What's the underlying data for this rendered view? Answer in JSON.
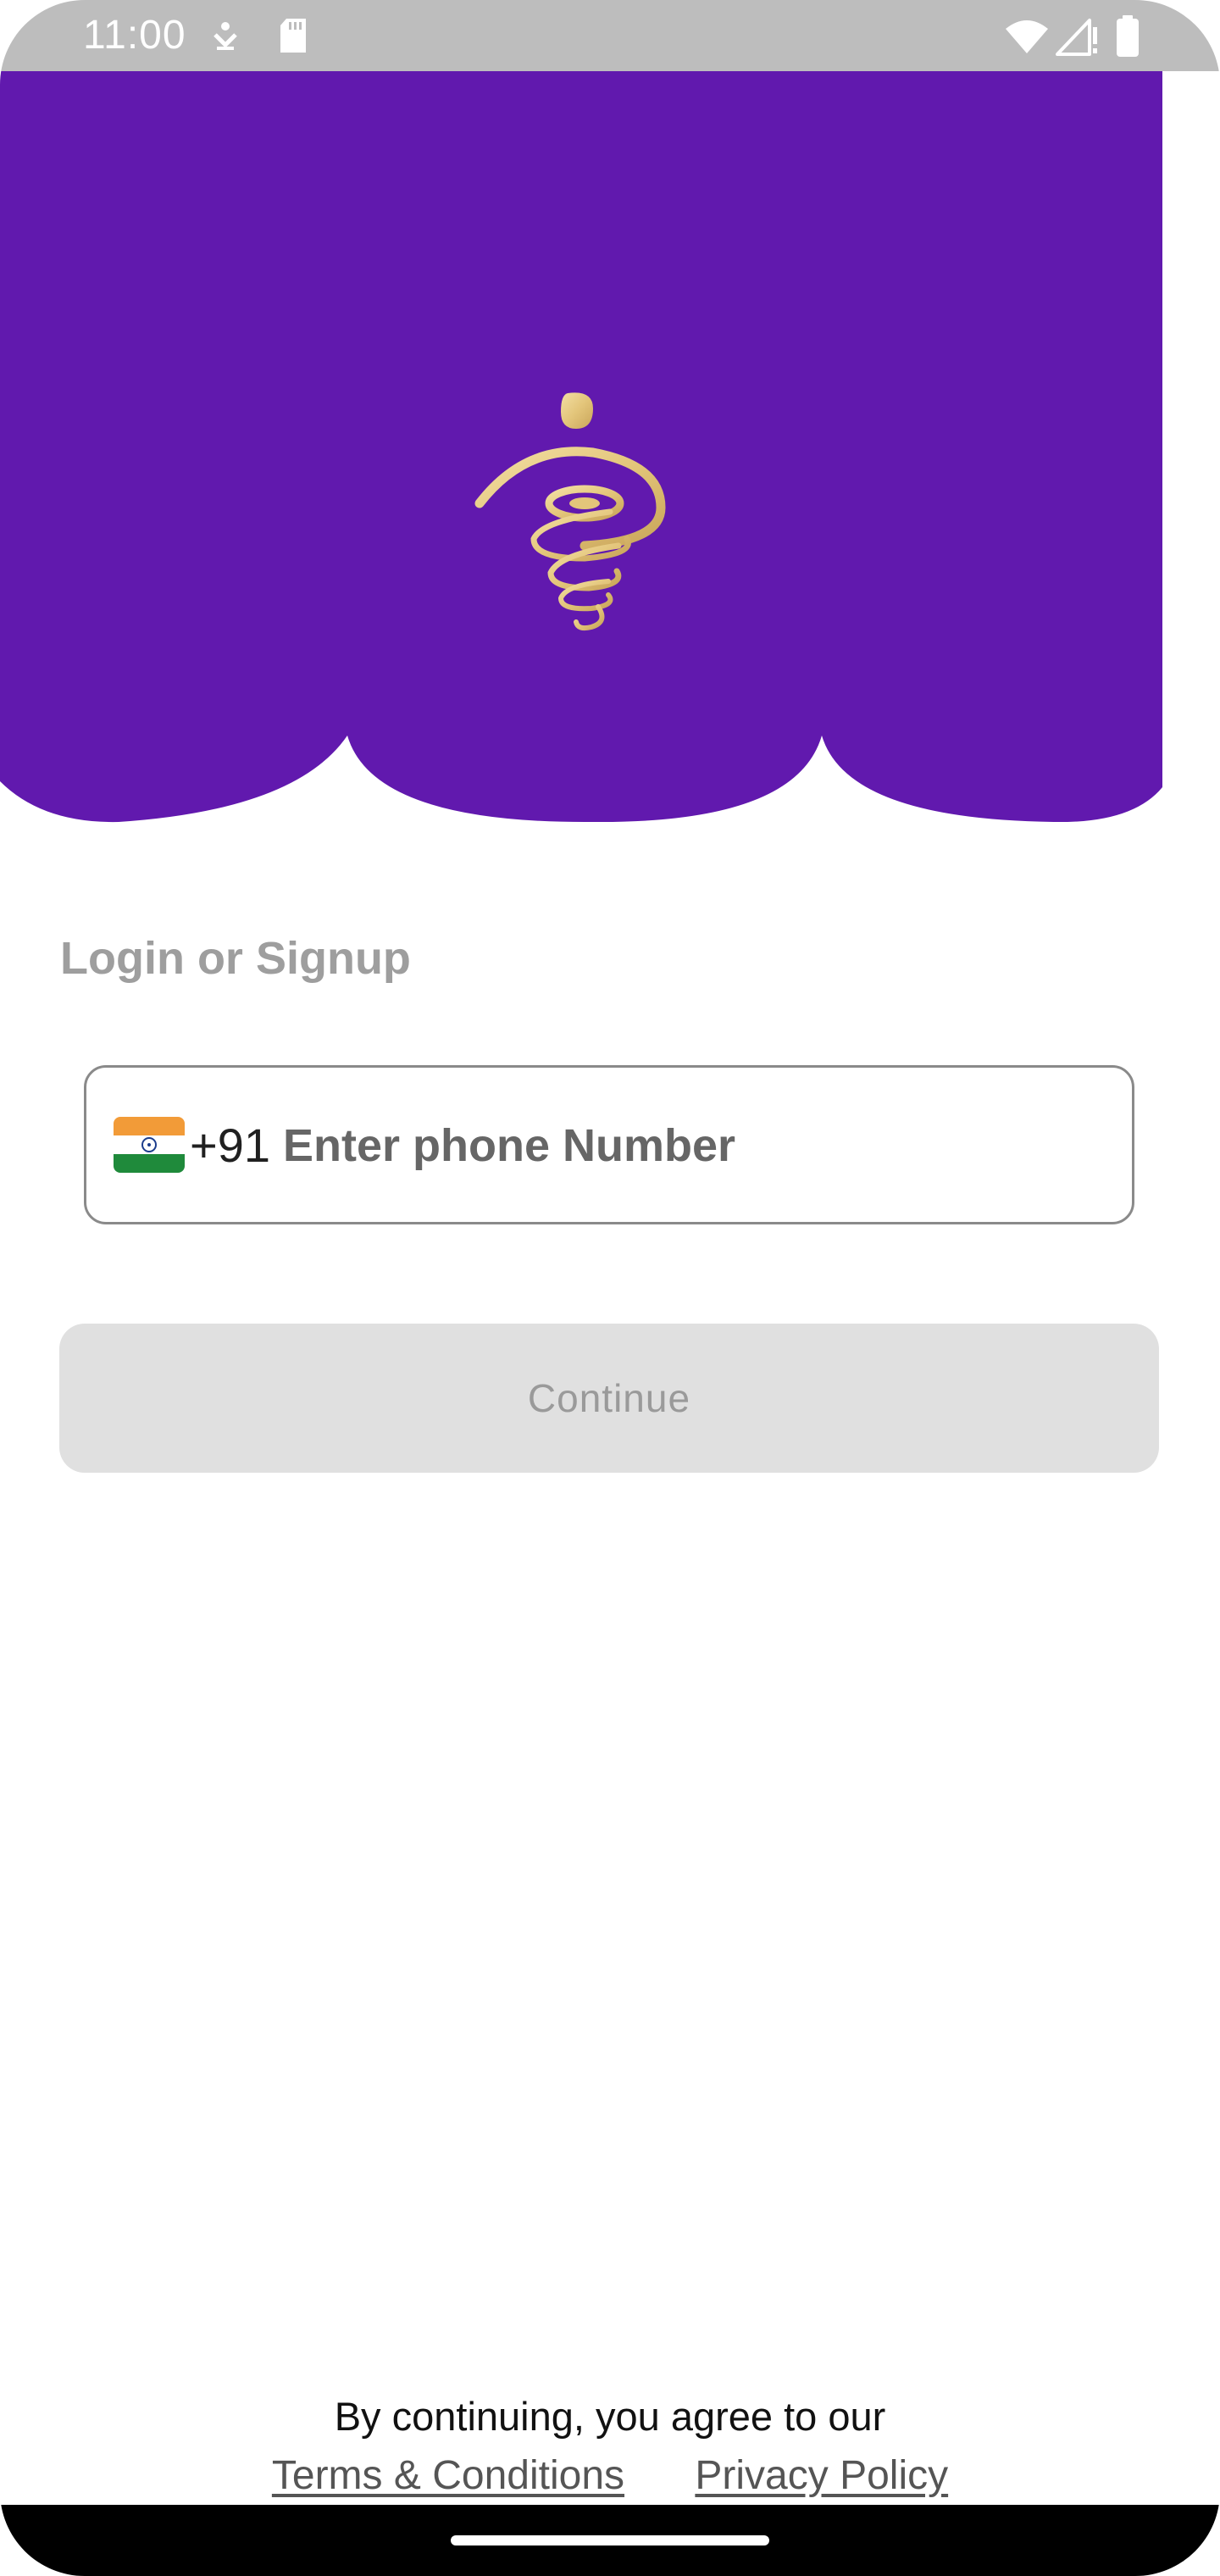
{
  "status_bar": {
    "time": "11:00",
    "icons": [
      "download-icon",
      "sd-card-icon",
      "wifi-icon",
      "signal-icon",
      "battery-icon"
    ]
  },
  "header": {
    "background_color": "#6119AE",
    "logo": "gold-spiral-logo",
    "logo_color": "#E9CF85"
  },
  "login": {
    "title": "Login or Signup",
    "country_flag": "india-flag-icon",
    "country_code": "+91",
    "phone_value": "",
    "phone_placeholder": "Enter phone Number",
    "continue_label": "Continue"
  },
  "footer": {
    "agreement_text": "By continuing, you agree to our",
    "terms_label": "Terms & Conditions",
    "privacy_label": "Privacy Policy"
  }
}
